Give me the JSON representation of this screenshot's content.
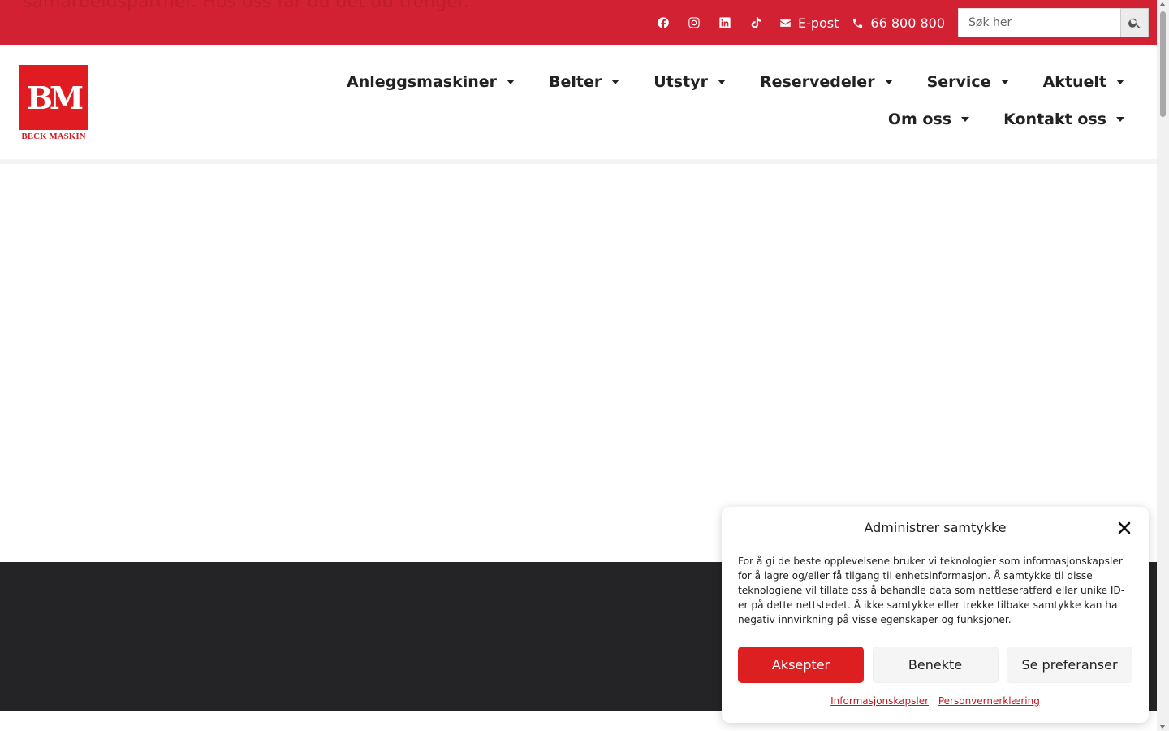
{
  "topbar": {
    "ghost_lines": [
      "samarbeidspartner. Hos oss får du det du trenger."
    ],
    "social_icons": [
      "facebook-icon",
      "instagram-icon",
      "linkedin-icon",
      "tiktok-icon"
    ],
    "email_label": "E-post",
    "phone_label": "66 800 800",
    "search_placeholder": "Søk her",
    "color": "#d12133"
  },
  "header": {
    "logo_letters": "BM",
    "logo_text": "BECK MASKIN",
    "nav": [
      {
        "label": "Anleggsmaskiner"
      },
      {
        "label": "Belter"
      },
      {
        "label": "Utstyr"
      },
      {
        "label": "Reservedeler"
      },
      {
        "label": "Service"
      },
      {
        "label": "Aktuelt"
      },
      {
        "label": "Om oss"
      },
      {
        "label": "Kontakt oss"
      }
    ]
  },
  "consent": {
    "title": "Administrer samtykke",
    "text": "For å gi de beste opplevelsene bruker vi teknologier som informasjonskapsler for å lagre og/eller få tilgang til enhetsinformasjon. Å samtykke til disse teknologiene vil tillate oss å behandle data som nettleseratferd eller unike ID-er på dette nettstedet. Å ikke samtykke eller trekke tilbake samtykke kan ha negativ innvirkning på visse egenskaper og funksjoner.",
    "accept_label": "Aksepter",
    "deny_label": "Benekte",
    "prefs_label": "Se preferanser",
    "link_cookies": "Informasjonskapsler",
    "link_privacy": "Personvernerklæring",
    "accent_color": "#dd1f22"
  },
  "footer": {
    "dark_color": "#242427"
  }
}
